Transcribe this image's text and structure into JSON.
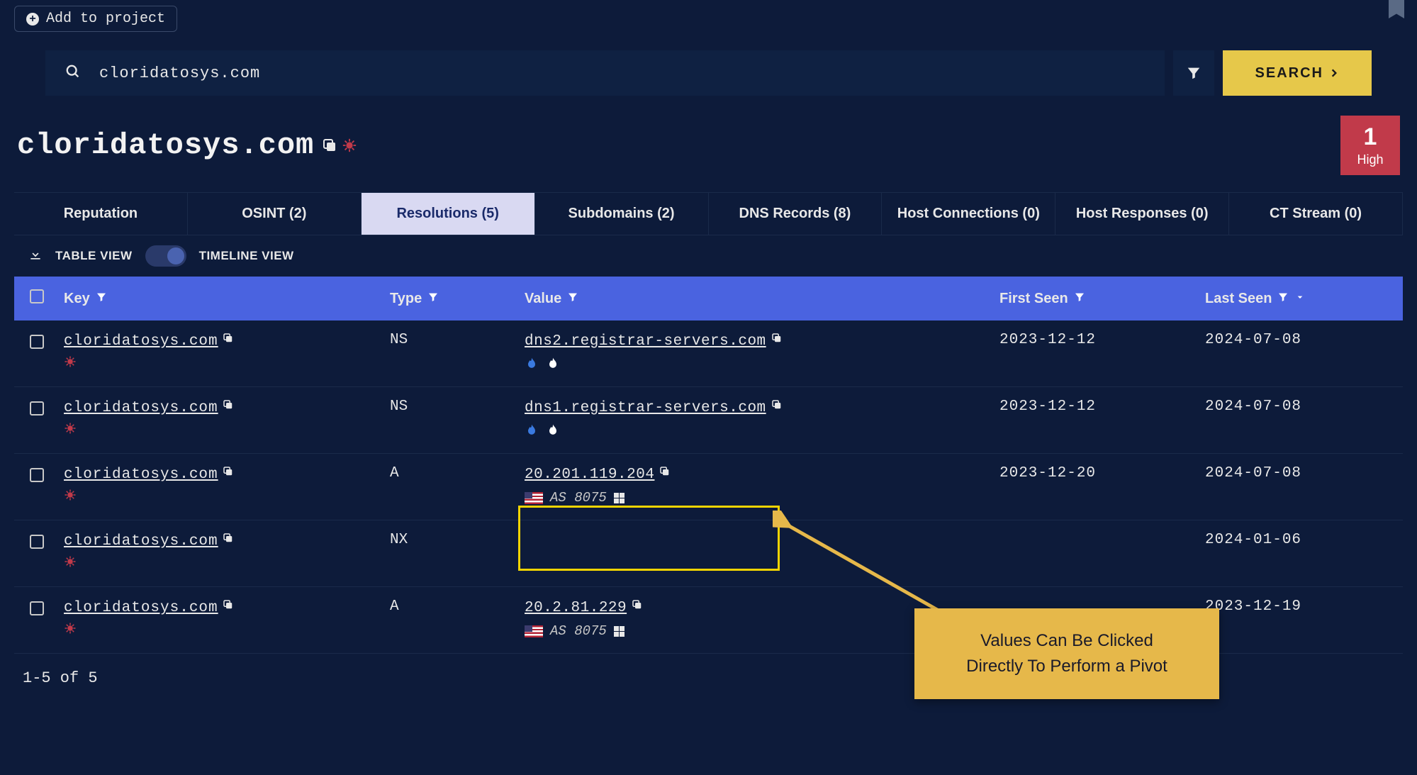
{
  "header": {
    "add_project_label": "Add to project",
    "search_value": "cloridatosys.com",
    "search_button": "SEARCH"
  },
  "title": {
    "domain": "cloridatosys.com",
    "risk_score": "1",
    "risk_level": "High"
  },
  "tabs": [
    {
      "label": "Reputation",
      "active": false
    },
    {
      "label": "OSINT (2)",
      "active": false
    },
    {
      "label": "Resolutions (5)",
      "active": true
    },
    {
      "label": "Subdomains (2)",
      "active": false
    },
    {
      "label": "DNS Records (8)",
      "active": false
    },
    {
      "label": "Host Connections (0)",
      "active": false
    },
    {
      "label": "Host Responses (0)",
      "active": false
    },
    {
      "label": "CT Stream (0)",
      "active": false
    }
  ],
  "toolbar": {
    "table_view": "TABLE VIEW",
    "timeline_view": "TIMELINE VIEW"
  },
  "columns": {
    "key": "Key",
    "type": "Type",
    "value": "Value",
    "first_seen": "First Seen",
    "last_seen": "Last Seen"
  },
  "rows": [
    {
      "key": "cloridatosys.com",
      "type": "NS",
      "value": "dns2.registrar-servers.com",
      "asn": "",
      "show_flag": false,
      "show_flames": true,
      "first_seen": "2023-12-12",
      "last_seen": "2024-07-08"
    },
    {
      "key": "cloridatosys.com",
      "type": "NS",
      "value": "dns1.registrar-servers.com",
      "asn": "",
      "show_flag": false,
      "show_flames": true,
      "first_seen": "2023-12-12",
      "last_seen": "2024-07-08"
    },
    {
      "key": "cloridatosys.com",
      "type": "A",
      "value": "20.201.119.204",
      "asn": "AS 8075",
      "show_flag": true,
      "show_flames": false,
      "first_seen": "2023-12-20",
      "last_seen": "2024-07-08"
    },
    {
      "key": "cloridatosys.com",
      "type": "NX",
      "value": "",
      "asn": "",
      "show_flag": false,
      "show_flames": false,
      "first_seen": "",
      "last_seen": "2024-01-06"
    },
    {
      "key": "cloridatosys.com",
      "type": "A",
      "value": "20.2.81.229",
      "asn": "AS 8075",
      "show_flag": true,
      "show_flames": false,
      "first_seen": "",
      "last_seen": "2023-12-19"
    }
  ],
  "paging": "1-5 of 5",
  "annotation": {
    "line1": "Values Can Be Clicked",
    "line2": "Directly To Perform a Pivot"
  }
}
